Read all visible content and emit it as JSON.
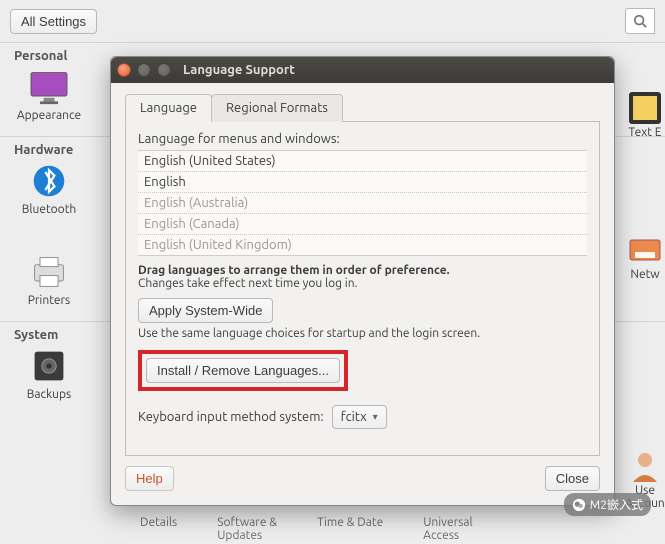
{
  "topbar": {
    "all_settings": "All Settings"
  },
  "categories": {
    "personal": "Personal",
    "hardware": "Hardware",
    "system": "System"
  },
  "apps": {
    "appearance": "Appearance",
    "bluetooth": "Bluetooth",
    "printers": "Printers",
    "backups": "Backups",
    "text_editor": "Text E",
    "network": "Netw",
    "user_accounts_1": "Use",
    "user_accounts_2": "Accoun"
  },
  "dialog": {
    "title": "Language Support",
    "tabs": {
      "language": "Language",
      "regional": "Regional Formats"
    },
    "lang_label": "Language for menus and windows:",
    "languages": [
      {
        "name": "English (United States)",
        "disabled": false
      },
      {
        "name": "English",
        "disabled": false
      },
      {
        "name": "English (Australia)",
        "disabled": true
      },
      {
        "name": "English (Canada)",
        "disabled": true
      },
      {
        "name": "English (United Kingdom)",
        "disabled": true
      }
    ],
    "drag_hint_bold": "Drag languages to arrange them in order of preference.",
    "drag_hint_sub": "Changes take effect next time you log in.",
    "apply_btn": "Apply System-Wide",
    "apply_hint": "Use the same language choices for startup and the login screen.",
    "install_btn": "Install / Remove Languages...",
    "kb_label": "Keyboard input method system:",
    "kb_value": "fcitx",
    "help_btn": "Help",
    "close_btn": "Close"
  },
  "truncated": {
    "details": "Details",
    "software": "Software &",
    "updates": "Updates",
    "timedate": "Time & Date",
    "universal": "Universal",
    "access": "Access"
  },
  "watermark": "M2嵌入式"
}
